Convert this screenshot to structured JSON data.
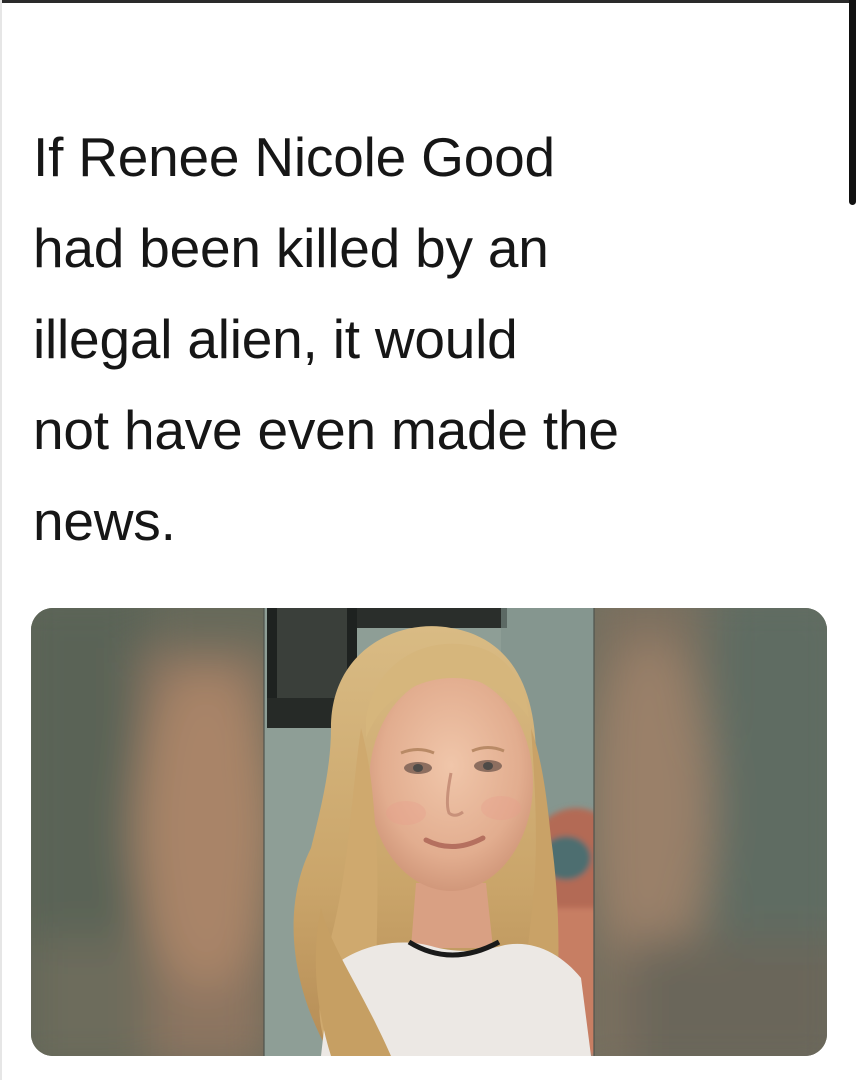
{
  "post": {
    "text": "If Renee Nicole Good\nhad been killed by an\nillegal alien, it would\nnot have even made the\nnews."
  },
  "media": {
    "icon": "photo-of-woman",
    "colors": {
      "blurred_background": "#6f7160",
      "wall": "#8fa098",
      "hair": "#d4b37a",
      "skin": "#e7b79a"
    }
  }
}
